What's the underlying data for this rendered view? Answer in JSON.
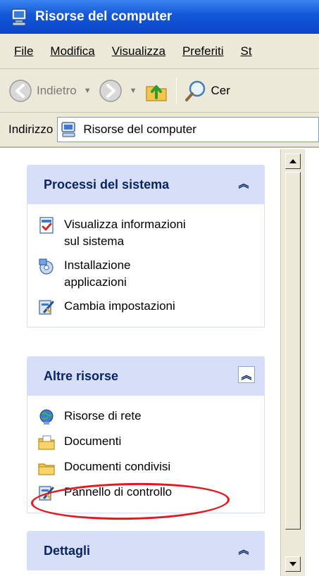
{
  "window": {
    "title": "Risorse del computer",
    "title_icon": "my-computer-icon"
  },
  "menubar": {
    "items": [
      {
        "label": "File",
        "accesskey": "F"
      },
      {
        "label": "Modifica",
        "accesskey": "M"
      },
      {
        "label": "Visualizza",
        "accesskey": "V"
      },
      {
        "label": "Preferiti",
        "accesskey": "P"
      },
      {
        "label": "St",
        "accesskey": "S"
      }
    ]
  },
  "toolbar": {
    "back_label": "Indietro",
    "back_icon": "back-arrow-icon",
    "forward_icon": "forward-arrow-icon",
    "up_icon": "folder-up-icon",
    "search_icon": "search-icon",
    "search_label": "Cer"
  },
  "address": {
    "label": "Indirizzo",
    "value": "Risorse del computer",
    "icon": "my-computer-icon"
  },
  "panels": {
    "system": {
      "title": "Processi del sistema",
      "tasks": [
        {
          "label": "Visualizza informazioni sul sistema",
          "line1": "Visualizza informazioni",
          "line2": "sul sistema",
          "icon": "system-info-icon"
        },
        {
          "label": "Installazione applicazioni",
          "line1": "Installazione",
          "line2": "applicazioni",
          "icon": "add-remove-programs-icon"
        },
        {
          "label": "Cambia impostazioni",
          "line1": "Cambia impostazioni",
          "icon": "control-panel-icon"
        }
      ]
    },
    "other": {
      "title": "Altre risorse",
      "items": [
        {
          "label": "Risorse di rete",
          "icon": "network-places-icon"
        },
        {
          "label": "Documenti",
          "icon": "my-documents-icon"
        },
        {
          "label": "Documenti condivisi",
          "icon": "shared-folder-icon"
        },
        {
          "label": "Pannello di controllo",
          "icon": "control-panel-icon"
        }
      ]
    },
    "details": {
      "title": "Dettagli"
    }
  },
  "colors": {
    "titlebar": "#1357d8",
    "panel_header": "#d6dff7",
    "panel_title": "#0a246a",
    "highlight": "#e8141e"
  }
}
